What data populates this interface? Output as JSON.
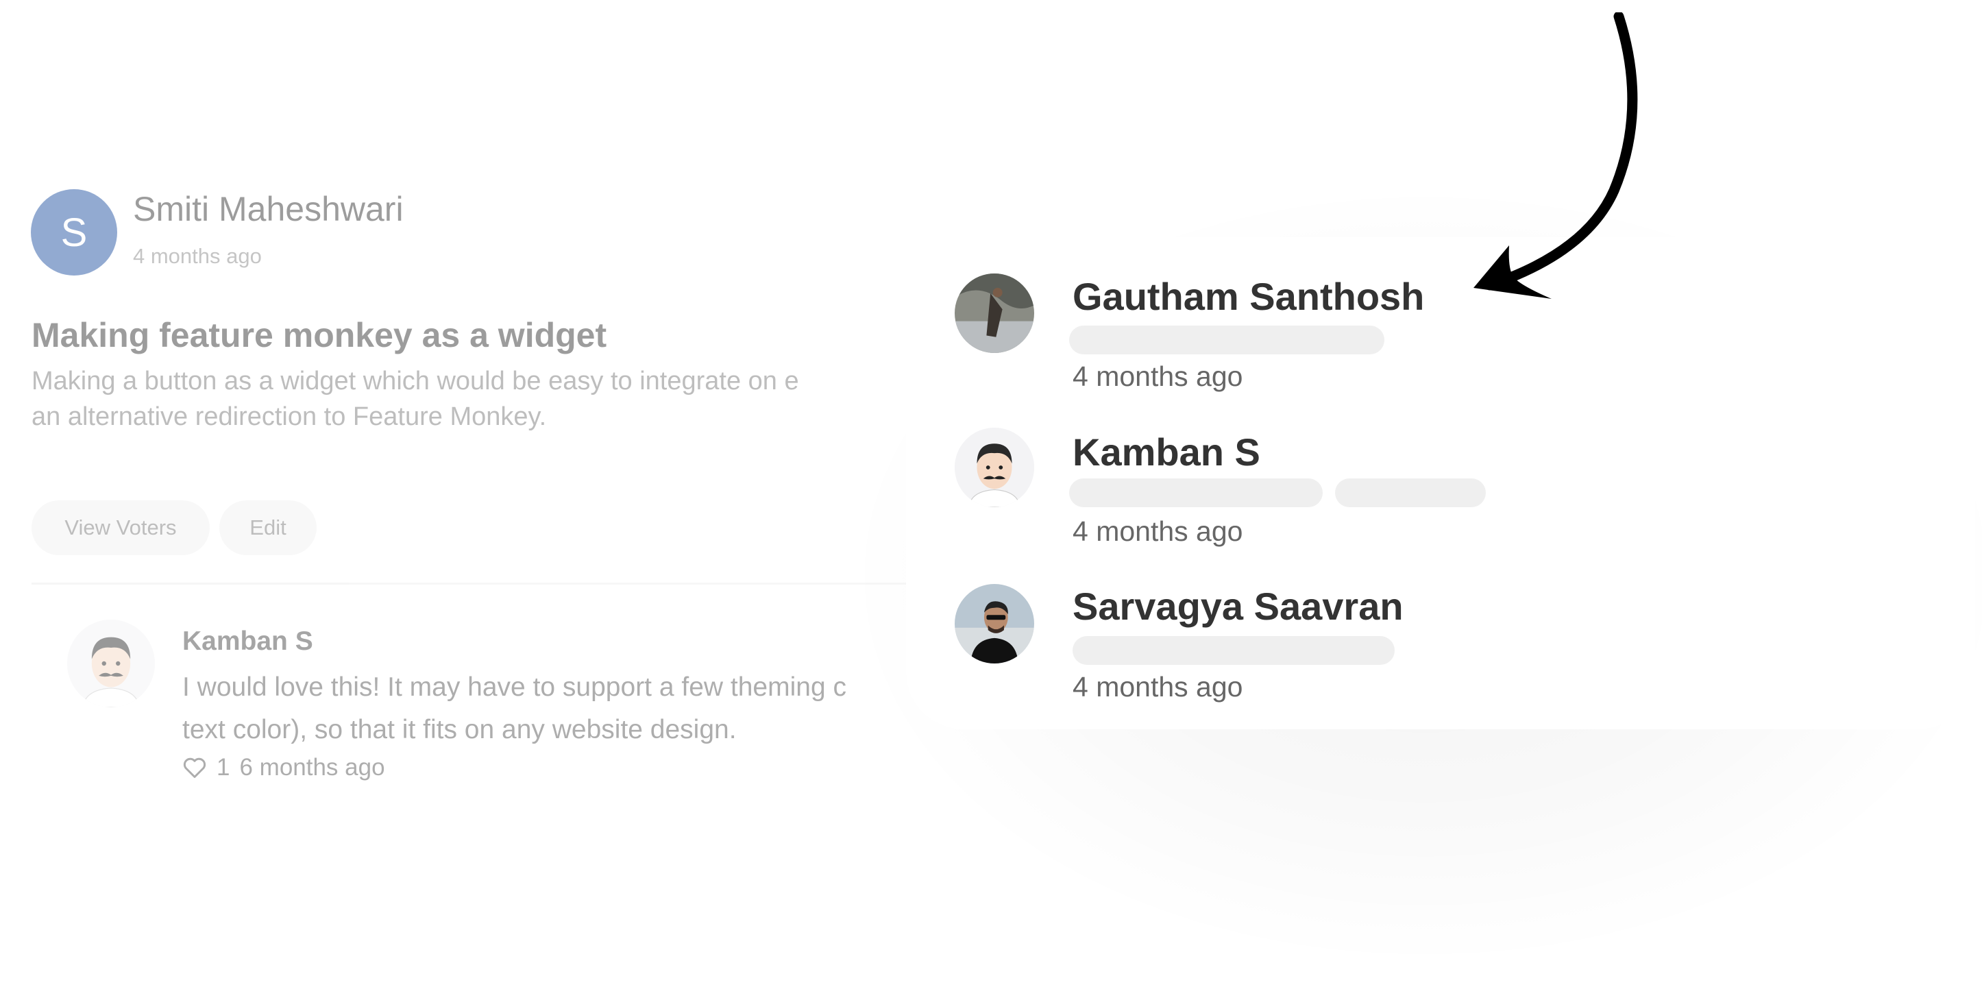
{
  "post": {
    "avatar_initial": "S",
    "author": "Smiti Maheshwari",
    "time": "4 months ago",
    "title": "Making feature monkey as a widget",
    "body_line1": "Making a button as a widget which would be easy to integrate on e",
    "body_line2": "an alternative redirection to Feature Monkey.",
    "avatar_color": "#1e4fa0"
  },
  "actions": {
    "view_voters_label": "View Voters",
    "edit_label": "Edit"
  },
  "comment": {
    "author": "Kamban S",
    "text_line1": "I would love this! It may have to support a few theming c",
    "text_line2": "text color), so that it fits on any website design.",
    "likes": "1",
    "time": "6 months ago",
    "icons": [
      "avatar-mustache-illustration",
      "heart-icon"
    ]
  },
  "voters": [
    {
      "name": "Gautham Santhosh",
      "time": "4 months ago",
      "avatar": "photo-icon"
    },
    {
      "name": "Kamban S",
      "time": "4 months ago",
      "avatar": "avatar-mustache-illustration"
    },
    {
      "name": "Sarvagya Saavran",
      "time": "4 months ago",
      "avatar": "photo-icon"
    }
  ],
  "decor": {
    "arrow_icon": "curved-arrow-icon"
  }
}
